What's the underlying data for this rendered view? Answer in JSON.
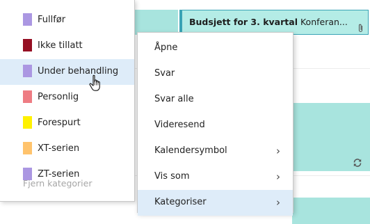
{
  "event": {
    "title": "Budsjett for 3. kvartal",
    "location": "Konferan..."
  },
  "category_menu": {
    "items": [
      {
        "label": "Fullfør",
        "color": "#ab97e2"
      },
      {
        "label": "Ikke tillatt",
        "color": "#950f23"
      },
      {
        "label": "Under behandling",
        "color": "#ab97e2"
      },
      {
        "label": "Personlig",
        "color": "#ee7c83"
      },
      {
        "label": "Forespurt",
        "color": "#fff100"
      },
      {
        "label": "XT-serien",
        "color": "#ffc36c"
      },
      {
        "label": "ZT-serien",
        "color": "#ab97e2"
      }
    ],
    "hovered_item": "Under behandling",
    "remove_label": "Fjern kategorier"
  },
  "context_menu": {
    "items": [
      {
        "label": "Åpne",
        "has_submenu": false
      },
      {
        "label": "Svar",
        "has_submenu": false
      },
      {
        "label": "Svar alle",
        "has_submenu": false
      },
      {
        "label": "Videresend",
        "has_submenu": false
      },
      {
        "label": "Kalendersymbol",
        "has_submenu": true
      },
      {
        "label": "Vis som",
        "has_submenu": true
      },
      {
        "label": "Kategoriser",
        "has_submenu": true
      }
    ],
    "active_item": "Kategoriser",
    "submenu_arrow": "›"
  },
  "icons": {
    "attachment": "paperclip-icon",
    "recurrence": "sync-icon",
    "cursor": "hand-pointer-icon"
  },
  "colors": {
    "event_fill": "#b4ece6",
    "event_border": "#39a3b5",
    "hover_fill": "#deecf9"
  }
}
